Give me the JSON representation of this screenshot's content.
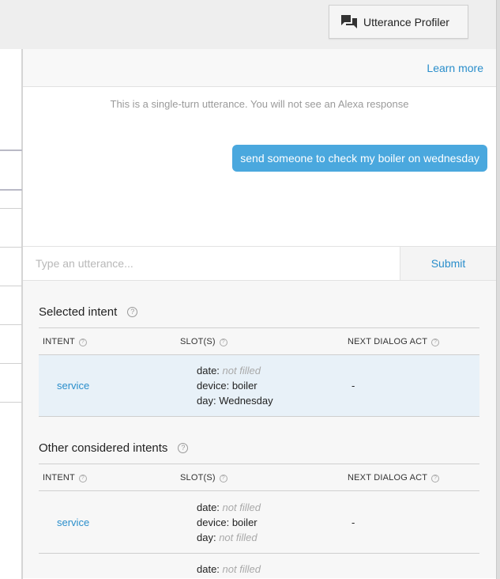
{
  "toolbar": {
    "profiler_button_label": "Utterance Profiler",
    "profiler_icon": "chat-bubbles-icon"
  },
  "drawer": {
    "learn_more": "Learn more",
    "single_turn_note": "This is a single-turn utterance. You will not see an Alexa response",
    "user_utterance": "send someone to check my boiler on wednesday",
    "input": {
      "placeholder": "Type an utterance...",
      "value": ""
    },
    "submit_label": "Submit"
  },
  "selected_intent": {
    "title": "Selected intent",
    "headers": {
      "intent": "INTENT",
      "slots": "SLOT(S)",
      "next": "NEXT DIALOG ACT"
    },
    "rows": [
      {
        "intent": "service",
        "slots": [
          {
            "name": "date:",
            "value": "not filled",
            "filled": false
          },
          {
            "name": "device:",
            "value": "boiler",
            "filled": true
          },
          {
            "name": "day:",
            "value": "Wednesday",
            "filled": true
          }
        ],
        "next": "-"
      }
    ]
  },
  "other_intents": {
    "title": "Other considered intents",
    "headers": {
      "intent": "INTENT",
      "slots": "SLOT(S)",
      "next": "NEXT DIALOG ACT"
    },
    "rows": [
      {
        "intent": "service",
        "slots": [
          {
            "name": "date:",
            "value": "not filled",
            "filled": false
          },
          {
            "name": "device:",
            "value": "boiler",
            "filled": true
          },
          {
            "name": "day:",
            "value": "not filled",
            "filled": false
          }
        ],
        "next": "-"
      },
      {
        "intent": "",
        "slots": [
          {
            "name": "date:",
            "value": "not filled",
            "filled": false
          }
        ],
        "next": ""
      }
    ]
  },
  "colors": {
    "accent": "#2a8ecb",
    "bubble": "#4aa8de",
    "selected_row": "#e8f1f8"
  }
}
